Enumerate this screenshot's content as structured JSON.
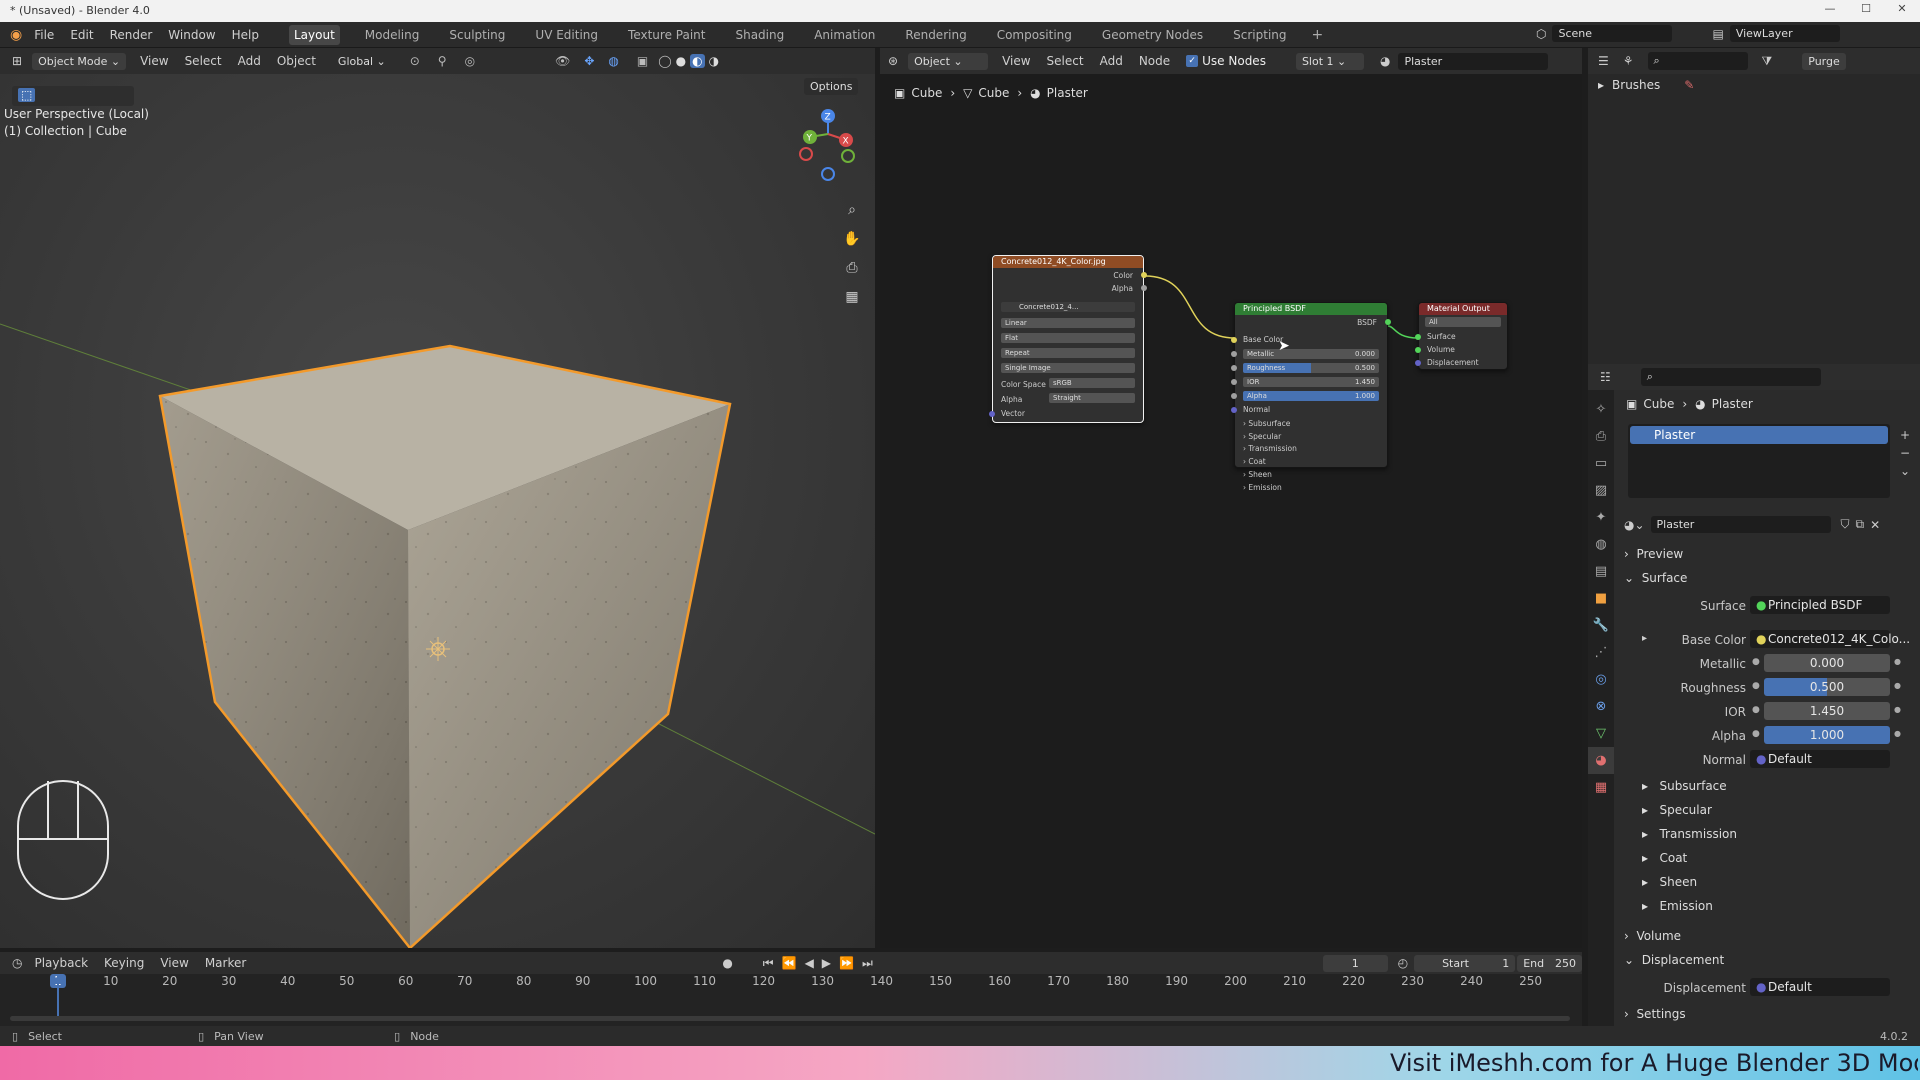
{
  "window": {
    "title": "* (Unsaved) - Blender 4.0"
  },
  "menu": [
    "File",
    "Edit",
    "Render",
    "Window",
    "Help"
  ],
  "workspaces": [
    "Layout",
    "Modeling",
    "Sculpting",
    "UV Editing",
    "Texture Paint",
    "Shading",
    "Animation",
    "Rendering",
    "Compositing",
    "Geometry Nodes",
    "Scripting"
  ],
  "top_right": {
    "scene": "Scene",
    "view_layer": "ViewLayer"
  },
  "viewport": {
    "mode": "Object Mode",
    "menus": [
      "View",
      "Select",
      "Add",
      "Object"
    ],
    "orientation": "Global",
    "options": "Options",
    "info_line1": "User Perspective (Local)",
    "info_line2": "(1) Collection | Cube",
    "gizmo": {
      "z": "Z",
      "y": "Y",
      "x": "X"
    }
  },
  "node_editor": {
    "type": "Object",
    "menus": [
      "View",
      "Select",
      "Add",
      "Node"
    ],
    "use_nodes": "Use Nodes",
    "slot": "Slot 1",
    "material": "Plaster",
    "breadcrumb": [
      "Cube",
      "Cube",
      "Plaster"
    ],
    "image_node": {
      "title": "Concrete012_4K_Color.jpg",
      "out_color": "Color",
      "out_alpha": "Alpha",
      "image": "Concrete012_4...",
      "interp": "Linear",
      "proj": "Flat",
      "ext": "Repeat",
      "source": "Single Image",
      "cs_label": "Color Space",
      "cs_value": "sRGB",
      "alpha_label": "Alpha",
      "alpha_value": "Straight",
      "vector": "Vector"
    },
    "bsdf_node": {
      "title": "Principled BSDF",
      "out": "BSDF",
      "base_color": "Base Color",
      "metallic_label": "Metallic",
      "metallic": "0.000",
      "roughness_label": "Roughness",
      "roughness": "0.500",
      "ior_label": "IOR",
      "ior": "1.450",
      "alpha_label": "Alpha",
      "alpha": "1.000",
      "normal": "Normal",
      "panels": [
        "Subsurface",
        "Specular",
        "Transmission",
        "Coat",
        "Sheen",
        "Emission"
      ]
    },
    "output_node": {
      "title": "Material Output",
      "target": "All",
      "surface": "Surface",
      "volume": "Volume",
      "displacement": "Displacement"
    }
  },
  "outliner": {
    "item": "Brushes",
    "purge": "Purge"
  },
  "properties": {
    "breadcrumb": [
      "Cube",
      "Plaster"
    ],
    "slot_item": "Plaster",
    "material_name": "Plaster",
    "sections": {
      "preview": "Preview",
      "surface": "Surface",
      "volume": "Volume",
      "displacement": "Displacement",
      "settings": "Settings"
    },
    "surface_label": "Surface",
    "surface_value": "Principled BSDF",
    "base_color_label": "Base Color",
    "base_color_value": "Concrete012_4K_Colo...",
    "metallic_label": "Metallic",
    "metallic": "0.000",
    "roughness_label": "Roughness",
    "roughness": "0.500",
    "ior_label": "IOR",
    "ior": "1.450",
    "alpha_label": "Alpha",
    "alpha": "1.000",
    "normal_label": "Normal",
    "normal_value": "Default",
    "subpanels": [
      "Subsurface",
      "Specular",
      "Transmission",
      "Coat",
      "Sheen",
      "Emission"
    ],
    "displacement_label": "Displacement",
    "displacement_value": "Default"
  },
  "timeline": {
    "menus": [
      "Playback",
      "Keying",
      "View",
      "Marker"
    ],
    "current_frame": "1",
    "start_label": "Start",
    "start": "1",
    "end_label": "End",
    "end": "250",
    "ticks": [
      "1",
      "10",
      "20",
      "30",
      "40",
      "50",
      "60",
      "70",
      "80",
      "90",
      "100",
      "110",
      "120",
      "130",
      "140",
      "150",
      "160",
      "170",
      "180",
      "190",
      "200",
      "210",
      "220",
      "230",
      "240",
      "250"
    ]
  },
  "statusbar": {
    "select": "Select",
    "pan": "Pan View",
    "node": "Node",
    "version": "4.0.2"
  },
  "banner": {
    "text": "Visit iMeshh.com for A Huge Blender 3D Mod"
  }
}
